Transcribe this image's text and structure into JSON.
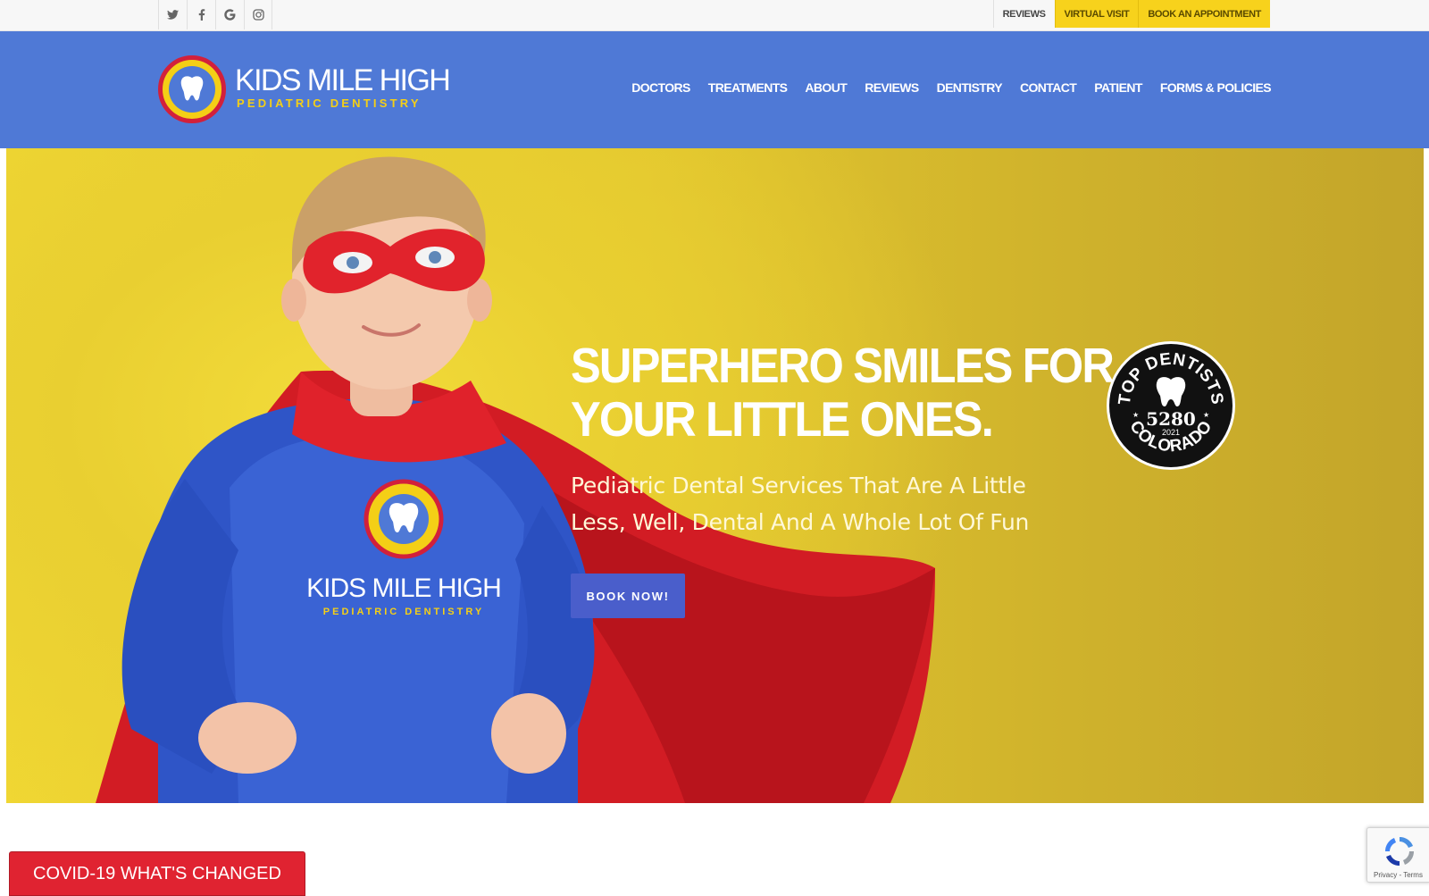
{
  "topbar": {
    "social_icons": [
      "twitter-icon",
      "facebook-icon",
      "google-icon",
      "instagram-icon"
    ],
    "social_glyphs": [
      "🐦",
      "f",
      "G",
      "◎"
    ],
    "links": [
      {
        "label": "REVIEWS",
        "style": "plain"
      },
      {
        "label": "VIRTUAL VISIT",
        "style": "yellow"
      },
      {
        "label": "BOOK AN APPOINTMENT",
        "style": "yellow"
      }
    ]
  },
  "header": {
    "logo_title": "KIDS MILE HIGH",
    "logo_subtitle": "PEDIATRIC DENTISTRY",
    "nav": [
      "DOCTORS",
      "TREATMENTS",
      "ABOUT",
      "REVIEWS",
      "DENTISTRY",
      "CONTACT",
      "PATIENT",
      "FORMS & POLICIES"
    ]
  },
  "hero": {
    "title_line1": "SUPERHERO SMILES FOR",
    "title_line2": "YOUR LITTLE ONES.",
    "subtitle": "Pediatric Dental Services That Are A Little Less, Well, Dental And A Whole Lot Of Fun",
    "cta": "BOOK NOW!",
    "shirt_logo_title": "KIDS MILE HIGH",
    "shirt_logo_subtitle": "PEDIATRIC DENTISTRY",
    "badge": {
      "top_text": "TOP DENTISTS",
      "number": "5280",
      "year": "2021",
      "bottom_text": "COLORADO"
    }
  },
  "covid_button": "COVID-19 WHAT'S CHANGED",
  "recaptcha": {
    "links": "Privacy - Terms"
  },
  "colors": {
    "header_blue": "#4f79d6",
    "brand_yellow": "#f4cf16",
    "brand_red": "#d2203b",
    "cta_blue": "#4a5ecb",
    "covid_red": "#e02331"
  }
}
